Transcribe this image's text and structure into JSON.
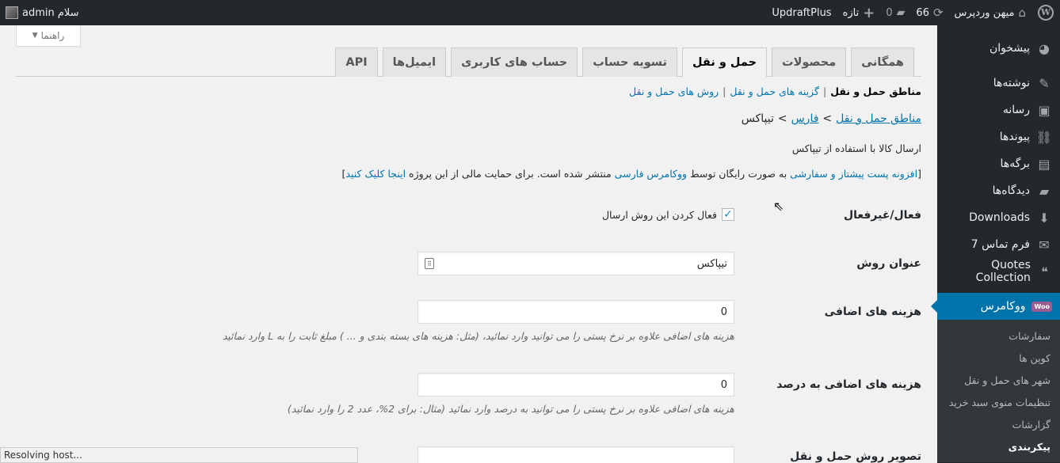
{
  "admin_bar": {
    "site_name": "میهن وردپرس",
    "updates_count": "66",
    "comments_count": "0",
    "new_label": "تازه",
    "plugin_label": "UpdraftPlus",
    "greeting": "سلام admin"
  },
  "sidebar": {
    "items": [
      {
        "label": "پیشخوان",
        "icon": "dashboard-icon",
        "glyph": "◕"
      },
      {
        "label": "نوشته‌ها",
        "icon": "pin-icon",
        "glyph": "✎"
      },
      {
        "label": "رسانه",
        "icon": "media-icon",
        "glyph": "▣"
      },
      {
        "label": "پیوندها",
        "icon": "link-icon",
        "glyph": "⛓"
      },
      {
        "label": "برگه‌ها",
        "icon": "page-icon",
        "glyph": "▤"
      },
      {
        "label": "دیدگاه‌ها",
        "icon": "comment-icon",
        "glyph": "▰"
      },
      {
        "label": "Downloads",
        "icon": "download-icon",
        "glyph": "⬇"
      },
      {
        "label": "فرم تماس 7",
        "icon": "mail-icon",
        "glyph": "✉"
      },
      {
        "label": "Quotes Collection",
        "icon": "quote-icon",
        "glyph": "❝"
      },
      {
        "label": "ووکامرس",
        "icon": "woocommerce-icon",
        "glyph": "Woo"
      }
    ],
    "submenu": [
      {
        "label": "سفارشات"
      },
      {
        "label": "کوپن ها"
      },
      {
        "label": "شهر های حمل و نقل"
      },
      {
        "label": "تنظیمات منوی سبد خرید"
      },
      {
        "label": "گزارشات"
      },
      {
        "label": "پیکربندی"
      }
    ]
  },
  "help": {
    "label": "راهنما"
  },
  "tabs": [
    {
      "label": "همگانی"
    },
    {
      "label": "محصولات"
    },
    {
      "label": "حمل و نقل",
      "active": true
    },
    {
      "label": "تسویه حساب"
    },
    {
      "label": "حساب های کاربری"
    },
    {
      "label": "ایمیل‌ها"
    },
    {
      "label": "API"
    }
  ],
  "subnav": {
    "current": "مناطق حمل و نقل",
    "links": [
      "گزینه های حمل و نقل",
      "روش های حمل و نقل"
    ]
  },
  "breadcrumb": {
    "link1": "مناطق حمل و نقل",
    "link2": "فارس",
    "current": "تیپاکس",
    "sep": ">"
  },
  "description": "ارسال کالا با استفاده از تیپاکس",
  "credit": {
    "open": "[",
    "link1": "افزونه پست پیشتاز و سفارشی",
    "text1": " به صورت رایگان توسط ",
    "link2": "ووکامرس فارسی",
    "text2": " منتشر شده است. برای حمایت مالی از این پروژه ",
    "link3": "اینجا کلیک کنید",
    "close": "]"
  },
  "form": {
    "enable": {
      "label": "فعال/غیرفعال",
      "checkbox_label": "فعال کردن این روش ارسال",
      "checked": true
    },
    "title": {
      "label": "عنوان روش",
      "value": "تیپاکس"
    },
    "extra_cost": {
      "label": "هزینه های اضافی",
      "value": "0",
      "hint": "هزینه های اضافی علاوه بر نرخ پستی را می توانید وارد نمائید، (مثل: هزینه های بسته بندی و ... ) مبلغ ثابت را به L وارد نمائید"
    },
    "extra_cost_percent": {
      "label": "هزینه های اضافی به درصد",
      "value": "0",
      "hint": "هزینه های اضافی علاوه بر نرخ پستی را می توانید به درصد وارد نمائید (مثال: برای 2%، عدد 2 را وارد نمائید)"
    },
    "image": {
      "label": "تصویر روش حمل و نقل",
      "value": ""
    }
  },
  "status_bar": "Resolving host..."
}
